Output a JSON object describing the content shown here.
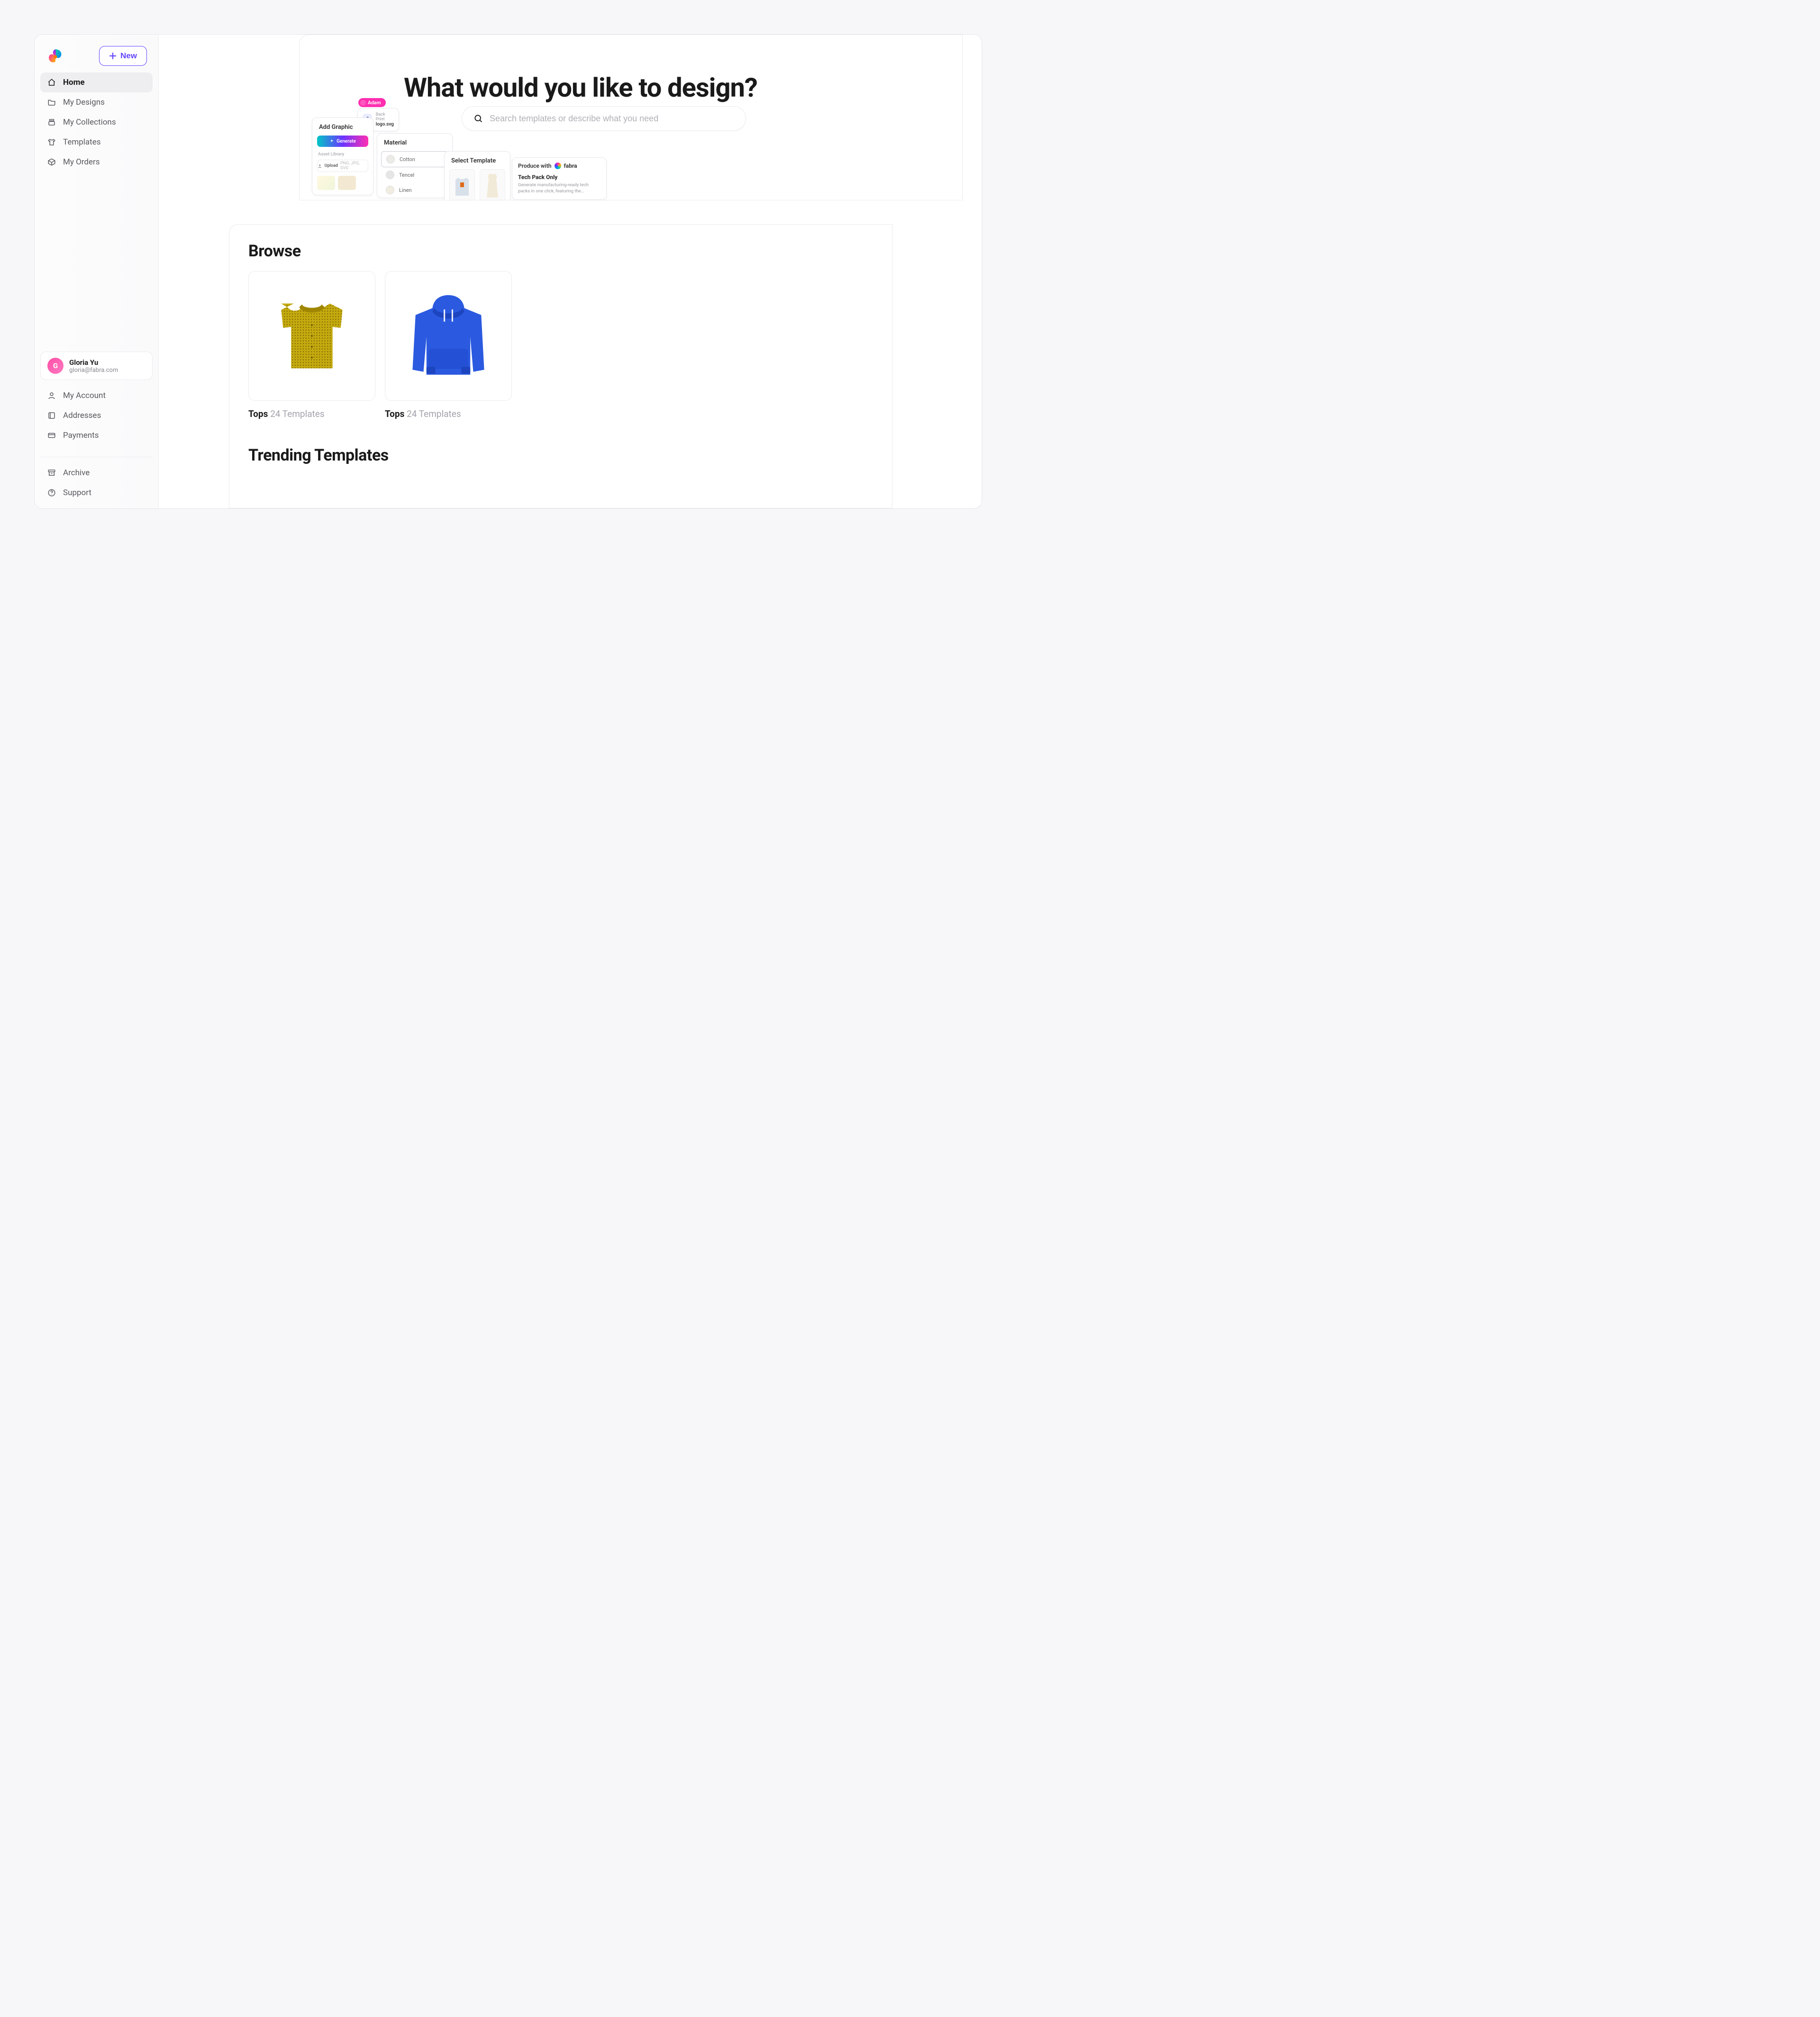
{
  "sidebar": {
    "new_btn": "New",
    "nav": [
      {
        "label": "Home",
        "icon": "home"
      },
      {
        "label": "My Designs",
        "icon": "folder"
      },
      {
        "label": "My Collections",
        "icon": "stack"
      },
      {
        "label": "Templates",
        "icon": "shirt"
      },
      {
        "label": "My Orders",
        "icon": "box"
      }
    ],
    "user": {
      "initial": "G",
      "name": "Gloria Yu",
      "email": "gloria@fabra.com"
    },
    "secondary": [
      {
        "label": "My Account",
        "icon": "person"
      },
      {
        "label": "Addresses",
        "icon": "address"
      },
      {
        "label": "Payments",
        "icon": "card"
      }
    ],
    "tertiary": [
      {
        "label": "Archive",
        "icon": "archive"
      },
      {
        "label": "Support",
        "icon": "help"
      }
    ]
  },
  "hero": {
    "title": "What would you like to design?",
    "search_placeholder": "Search templates or describe what you need",
    "pill_name": "Adam",
    "file": {
      "line1": "Back Print",
      "line2": "logo.svg"
    },
    "add_graphic": {
      "title": "Add Graphic",
      "generate": "Generate",
      "library": "Asset Library",
      "upload": "Upload",
      "formats": "PNG, JPG, SVG"
    },
    "material": {
      "title": "Material",
      "options": [
        "Cotton",
        "Tencel",
        "Linen"
      ]
    },
    "select_template": {
      "title": "Select Template"
    },
    "produce": {
      "title": "Produce with",
      "brand": "fabra",
      "card_title": "Tech Pack Only",
      "card_desc": "Generate manufacturing-ready tech packs in one click, featuring the…"
    }
  },
  "browse": {
    "title": "Browse",
    "cards": [
      {
        "cat": "Tops",
        "count": "24 Templates"
      },
      {
        "cat": "Tops",
        "count": "24 Templates"
      }
    ]
  },
  "trending": {
    "title": "Trending Templates"
  }
}
